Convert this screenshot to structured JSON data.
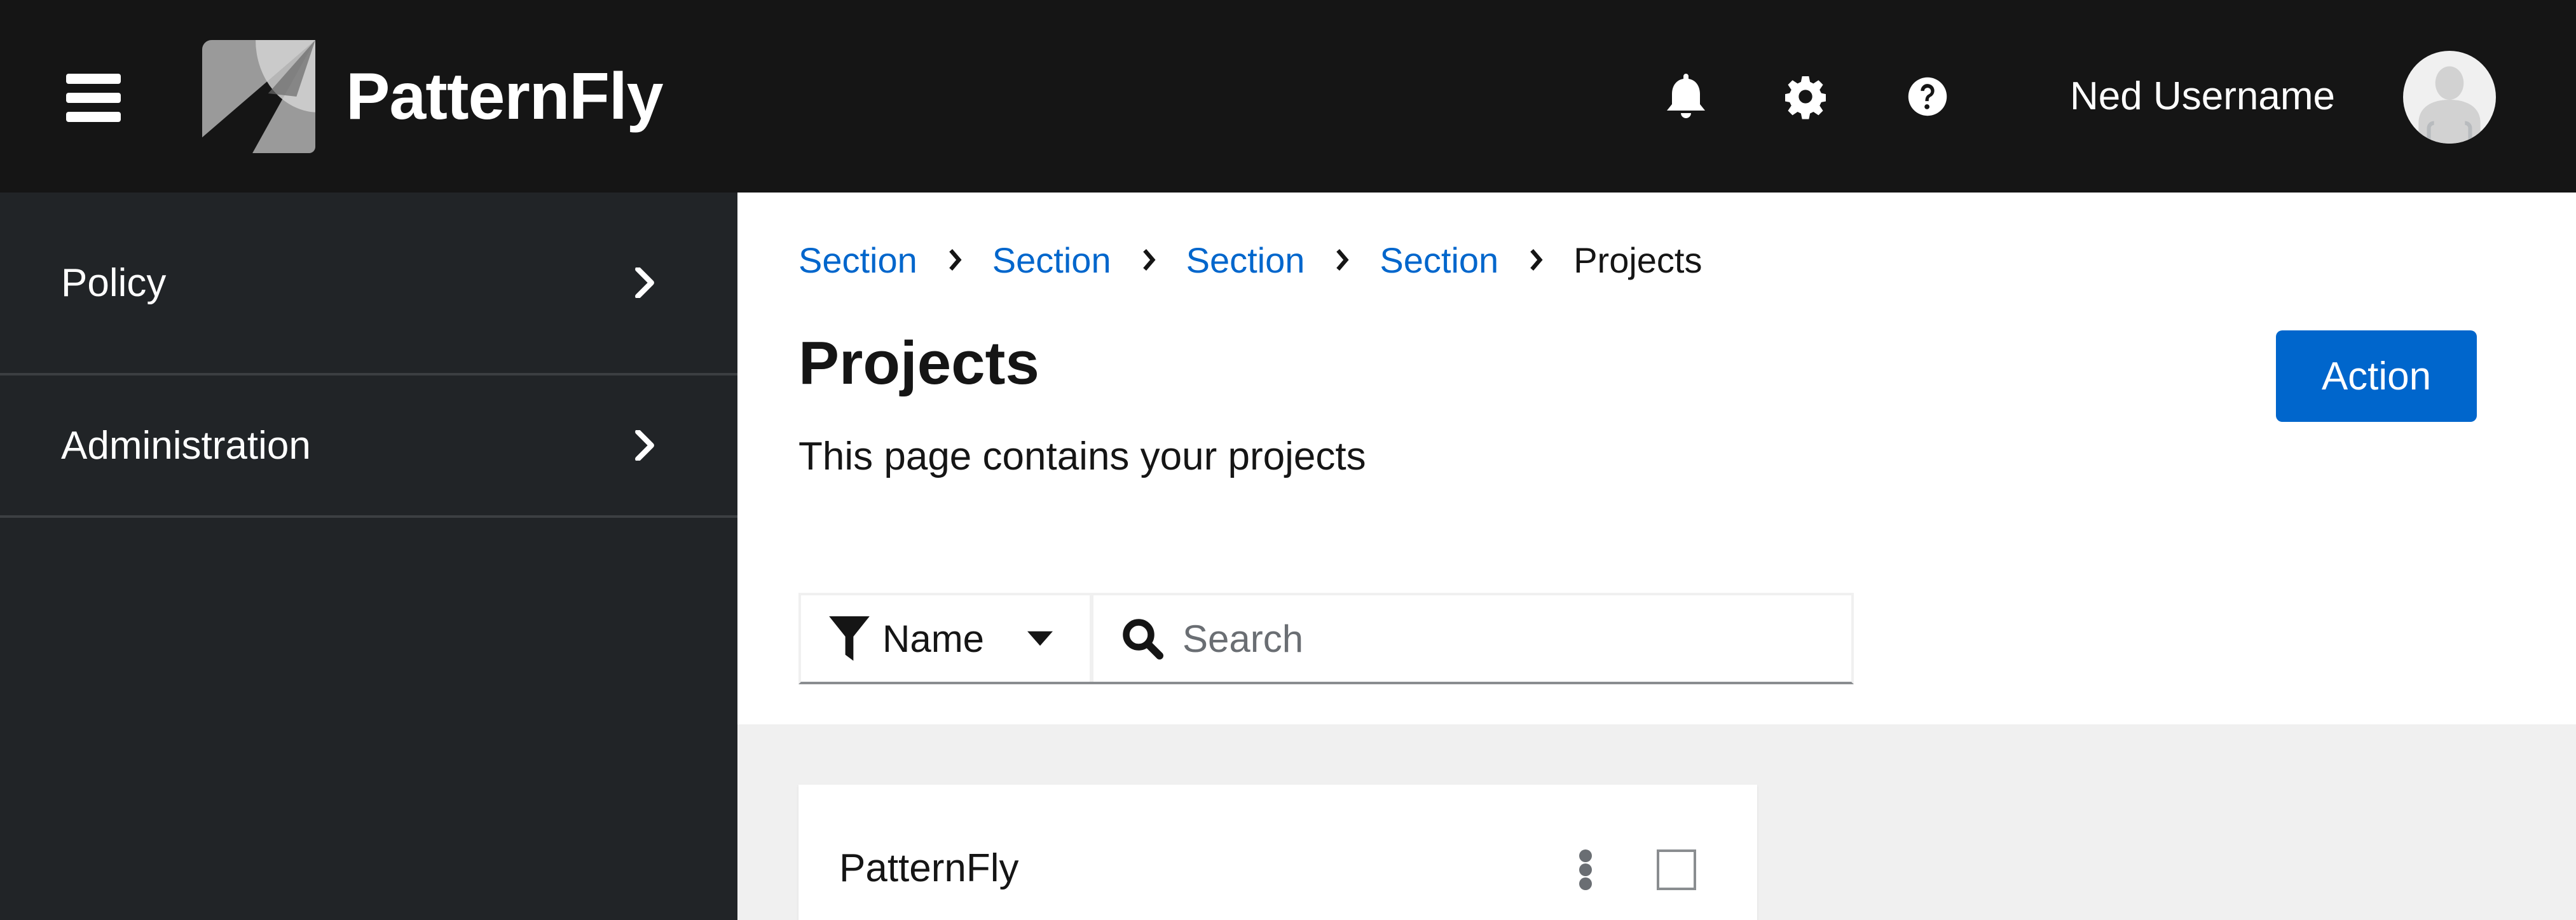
{
  "header": {
    "brand_name": "PatternFly",
    "icons": [
      "hamburger-menu-icon",
      "bell-icon",
      "gear-icon",
      "question-circle-icon"
    ],
    "username": "Ned Username"
  },
  "sidebar": {
    "items": [
      {
        "label": "Policy"
      },
      {
        "label": "Administration"
      }
    ]
  },
  "breadcrumb": {
    "items": [
      {
        "label": "Section"
      },
      {
        "label": "Section"
      },
      {
        "label": "Section"
      },
      {
        "label": "Section"
      }
    ],
    "current": "Projects"
  },
  "page": {
    "title": "Projects",
    "description": "This page contains your projects",
    "action_label": "Action"
  },
  "toolbar": {
    "filter_label": "Name",
    "search_placeholder": "Search",
    "search_value": ""
  },
  "cards": [
    {
      "title": "PatternFly",
      "selected": false
    }
  ],
  "colors": {
    "masthead_bg": "#151515",
    "sidebar_bg": "#212427",
    "link": "#0066cc",
    "primary_button": "#0066cc",
    "page_bg": "#f0f0f0"
  }
}
